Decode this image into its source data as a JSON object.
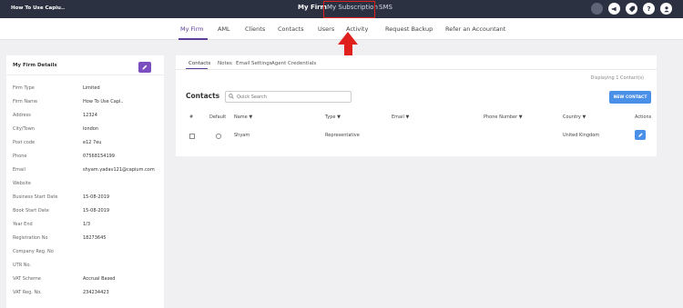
{
  "topbar": {
    "brand": "How To Use Capiu..",
    "nav": [
      "My Firm",
      "My Subscription",
      "SMS"
    ],
    "icons": [
      "avatar-blank-icon",
      "megaphone-icon",
      "tag-icon",
      "help-icon",
      "user-icon"
    ]
  },
  "subnav": {
    "items": [
      "My Firm",
      "AML",
      "Clients",
      "Contacts",
      "Users",
      "Activity",
      "Request Backup",
      "Refer an Accountant"
    ],
    "active": "My Firm"
  },
  "firm_details": {
    "title": "My Firm Details",
    "fields": [
      {
        "label": "Firm Type",
        "value": "Limited"
      },
      {
        "label": "Firm Name",
        "value": "How To Use Capi.."
      },
      {
        "label": "Address",
        "value": "12324"
      },
      {
        "label": "City/Town",
        "value": "london"
      },
      {
        "label": "Post code",
        "value": "e12 7eu"
      },
      {
        "label": "Phone",
        "value": "07568154199"
      },
      {
        "label": "Email",
        "value": "shyam.yadav121@capium.com"
      },
      {
        "label": "Website",
        "value": ""
      },
      {
        "label": "Business Start Date",
        "value": "15-08-2019"
      },
      {
        "label": "Book Start Date",
        "value": "15-08-2019"
      },
      {
        "label": "Year End",
        "value": "1/3"
      },
      {
        "label": "Registration No",
        "value": "18273645"
      },
      {
        "label": "Company Reg. No",
        "value": ""
      },
      {
        "label": "UTR No.",
        "value": ""
      },
      {
        "label": "VAT Scheme",
        "value": "Accrual Based"
      },
      {
        "label": "VAT Reg. No.",
        "value": "234234423"
      }
    ]
  },
  "contacts_panel": {
    "tabs": [
      "Contacts",
      "Notes",
      "Email Settings",
      "Agent Credentials"
    ],
    "displaying": "Displaying 1 Contact(s)",
    "title": "Contacts",
    "search_placeholder": "Quick Search",
    "new_button": "NEW CONTACT",
    "columns": [
      "#",
      "Default",
      "Name ▼",
      "Type ▼",
      "Email ▼",
      "Phone Number ▼",
      "Country ▼",
      "Actions"
    ],
    "rows": [
      {
        "name": "Shyam",
        "type": "Representative",
        "email": "",
        "phone": "",
        "country": "United Kingdom"
      }
    ]
  },
  "colors": {
    "topbar": "#2b3140",
    "accent": "#5c3d99",
    "highlight": "#e0201c",
    "button_blue": "#4a8fe8"
  }
}
